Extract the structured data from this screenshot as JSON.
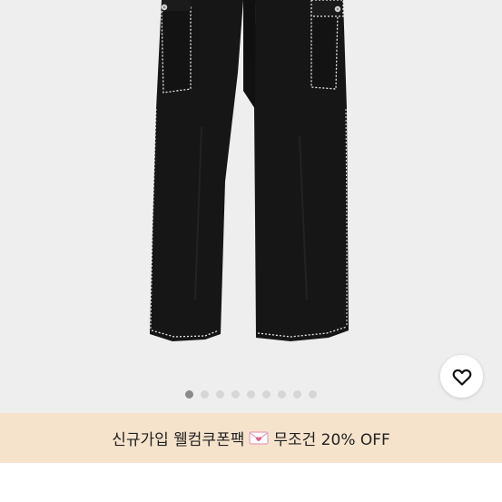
{
  "gallery": {
    "slide_count": 9,
    "active_index": 0
  },
  "wishlist": {
    "icon": "heart-outline-icon"
  },
  "promo": {
    "text_before": "신규가입 웰컴쿠폰팩",
    "icon": "love-letter-icon",
    "text_after": "무조건 20% OFF"
  },
  "colors": {
    "gallery_bg": "#eeeeee",
    "promo_bg": "#f6e3cc",
    "pants": "#141414",
    "stitch": "#f2f2f2",
    "pager_active": "#8a8a8a",
    "pager_inactive": "#d6d6d6"
  }
}
